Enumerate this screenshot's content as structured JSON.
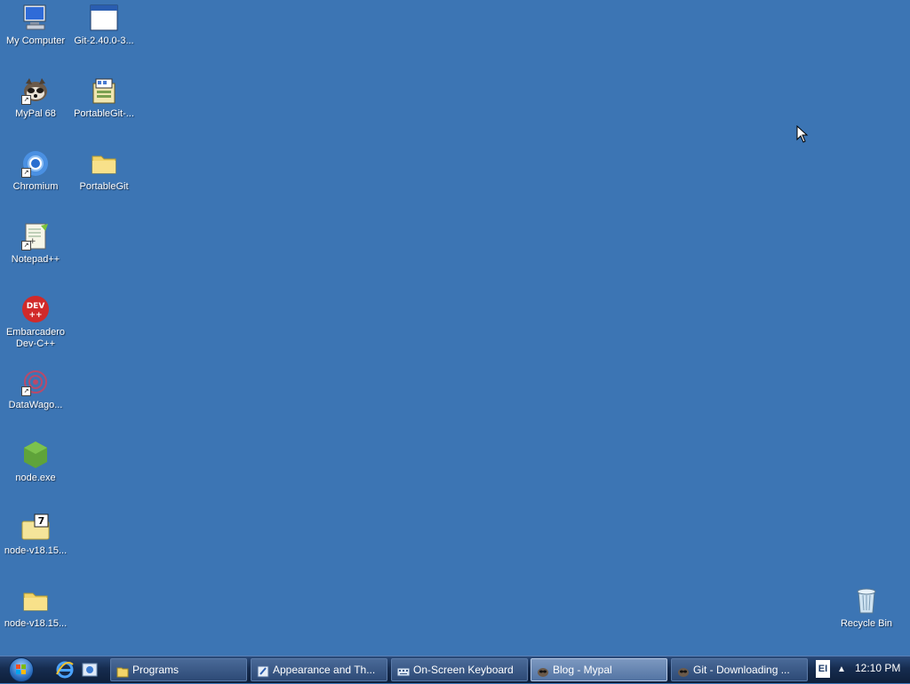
{
  "desktop_icons": {
    "my_computer": {
      "label": "My Computer",
      "icon": "computer-icon"
    },
    "git_installer": {
      "label": "Git-2.40.0-3...",
      "icon": "window-app-icon"
    },
    "mypal": {
      "label": "MyPal 68",
      "icon": "mypal-browser-icon"
    },
    "portablegit_exe": {
      "label": "PortableGit-...",
      "icon": "installer-icon"
    },
    "chromium": {
      "label": "Chromium",
      "icon": "chromium-icon"
    },
    "portablegit_folder": {
      "label": "PortableGit",
      "icon": "folder-icon"
    },
    "notepadpp": {
      "label": "Notepad++",
      "icon": "notepad-plus-plus-icon"
    },
    "devcpp": {
      "label": "Embarcadero Dev-C++",
      "icon_text": "DEV\n++",
      "icon": "devcpp-icon"
    },
    "datawagon": {
      "label": "DataWago...",
      "icon": "datawagon-icon"
    },
    "node_exe": {
      "label": "node.exe",
      "icon": "nodejs-icon"
    },
    "node_archive": {
      "label": "node-v18.15...",
      "icon": "7zip-archive-icon"
    },
    "node_folder": {
      "label": "node-v18.15...",
      "icon": "folder-icon"
    },
    "recycle_bin": {
      "label": "Recycle Bin",
      "icon": "recycle-bin-icon"
    }
  },
  "taskbar": {
    "tasks": [
      {
        "label": "Programs",
        "icon": "folder-icon",
        "active": false
      },
      {
        "label": "Appearance and Th...",
        "icon": "control-panel-icon",
        "active": false
      },
      {
        "label": "On-Screen Keyboard",
        "icon": "keyboard-icon",
        "active": false
      },
      {
        "label": "Blog - Mypal",
        "icon": "mypal-browser-icon",
        "active": true
      },
      {
        "label": "Git - Downloading ...",
        "icon": "mypal-browser-icon",
        "active": false
      }
    ],
    "language": "EI",
    "clock": "12:10 PM"
  },
  "colors": {
    "desktop": "#3c75b4",
    "taskbar": "#162c4f"
  }
}
